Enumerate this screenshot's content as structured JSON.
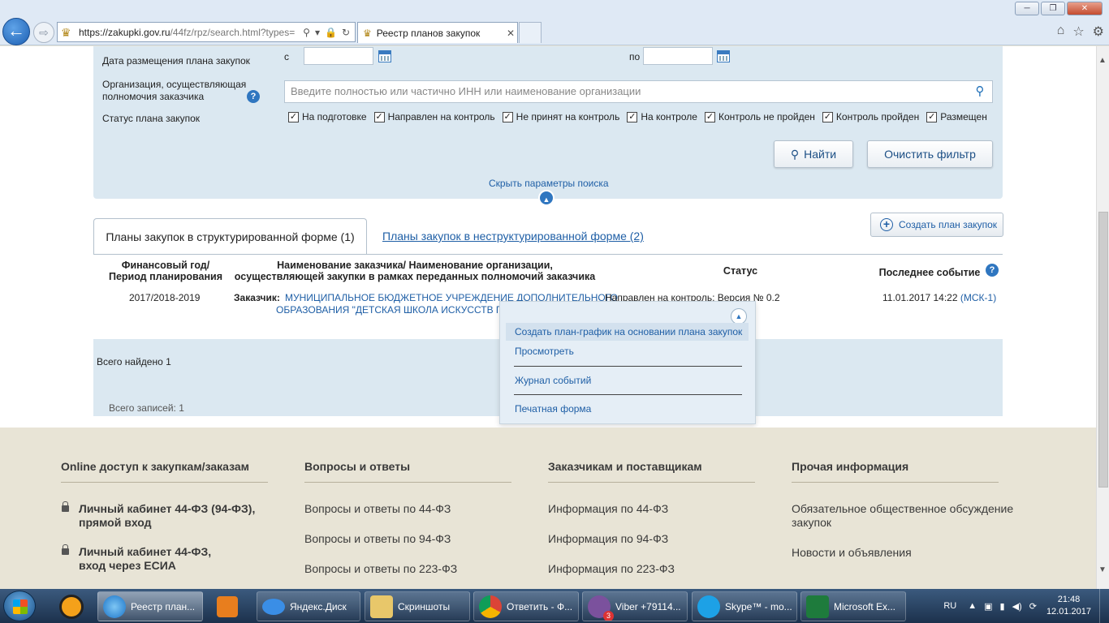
{
  "browser": {
    "url_main": "https://zakupki.gov.ru",
    "url_rest": "/44fz/rpz/search.html?types=",
    "tab_title": "Реестр планов закупок"
  },
  "filter": {
    "date_label": "Дата размещения плана закупок",
    "date_from_label": "с",
    "date_to_label": "по",
    "org_label": "Организация, осуществляющая полномочия заказчика",
    "org_placeholder": "Введите полностью или частично ИНН или наименование организации",
    "status_label": "Статус плана закупок",
    "statuses": [
      {
        "label": "На подготовке",
        "checked": true
      },
      {
        "label": "Направлен на контроль",
        "checked": true
      },
      {
        "label": "Не принят на контроль",
        "checked": true
      },
      {
        "label": "На контроле",
        "checked": true
      },
      {
        "label": "Контроль не пройден",
        "checked": true
      },
      {
        "label": "Контроль пройден",
        "checked": true
      },
      {
        "label": "Размещен",
        "checked": true
      }
    ],
    "find_label": "Найти",
    "clear_label": "Очистить фильтр",
    "hide_label": "Скрыть параметры поиска"
  },
  "tabs": {
    "active": "Планы закупок в структурированной форме (1)",
    "other": "Планы закупок в неструктурированной форме (2)",
    "create_label": "Создать план закупок"
  },
  "table": {
    "headers": {
      "year": "Финансовый год/\nПериод планирования",
      "customer": "Наименование заказчика/ Наименование организации,\nосуществляющей закупки в рамках переданных полномочий заказчика",
      "status": "Статус",
      "event": "Последнее событие"
    },
    "row": {
      "year": "2017/2018-2019",
      "customer_prefix": "Заказчик:",
      "customer_name": "МУНИЦИПАЛЬНОЕ БЮДЖЕТНОЕ УЧРЕЖДЕНИЕ ДОПОЛНИТЕЛЬНОГО",
      "customer_name2": "ОБРАЗОВАНИЯ \"ДЕТСКАЯ ШКОЛА ИСКУССТВ Г.ПР",
      "status": "Направлен на контроль; Версия № 0.2",
      "event_time": "11.01.2017 14:22",
      "event_tz": "(МСК-1)"
    },
    "total_found": "Всего найдено 1",
    "total_records": "Всего записей: 1"
  },
  "popup": {
    "items": [
      "Создать план-график на основании плана закупок",
      "Просмотреть",
      "Журнал событий",
      "Печатная форма"
    ]
  },
  "footer": {
    "columns": [
      {
        "title": "Online доступ к закупкам/заказам",
        "links": [
          "Личный кабинет 44-ФЗ (94-ФЗ),\nпрямой вход",
          "Личный кабинет 44-ФЗ,\nвход через ЕСИА"
        ]
      },
      {
        "title": "Вопросы и ответы",
        "links": [
          "Вопросы и ответы по 44-ФЗ",
          "Вопросы и ответы по 94-ФЗ",
          "Вопросы и ответы по 223-ФЗ"
        ]
      },
      {
        "title": "Заказчикам и поставщикам",
        "links": [
          "Информация по 44-ФЗ",
          "Информация по 94-ФЗ",
          "Информация по 223-ФЗ"
        ]
      },
      {
        "title": "Прочая информация",
        "links": [
          "Обязательное общественное обсуждение\nзакупок",
          "Новости и объявления"
        ]
      }
    ]
  },
  "taskbar": {
    "items": [
      "Реестр план...",
      "Яндекс.Диск",
      "Скриншоты",
      "Ответить - Ф...",
      "Viber +79114...",
      "Skype™ - mo...",
      "Microsoft Ex..."
    ],
    "viber_badge": "3",
    "lang": "RU",
    "time": "21:48",
    "date": "12.01.2017"
  }
}
